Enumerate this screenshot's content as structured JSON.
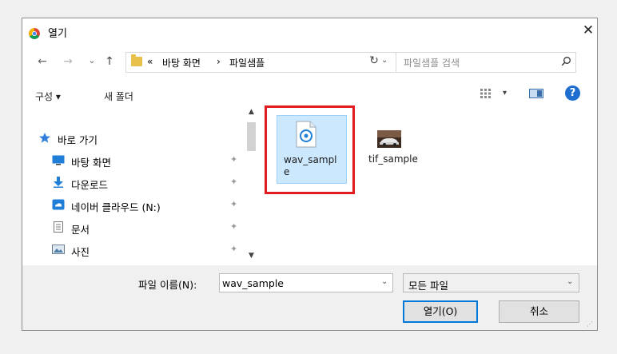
{
  "window": {
    "title": "열기",
    "close_symbol": "✕"
  },
  "nav": {
    "back": "←",
    "forward": "→",
    "recent": "⌄",
    "up": "↑"
  },
  "address": {
    "overflow": "«",
    "crumb1": "바탕 화면",
    "sep": "›",
    "crumb2": "파일샘플",
    "dropdown": "⌄"
  },
  "refresh": "↻",
  "search": {
    "placeholder": "파일샘플 검색",
    "icon": "search-icon"
  },
  "toolbar": {
    "organize": "구성 ▾",
    "new_folder": "새 폴더",
    "views_drop": "▾"
  },
  "sidebar": {
    "items": [
      {
        "label": "바로 가기",
        "icon": "star-icon",
        "pin": ""
      },
      {
        "label": "바탕 화면",
        "icon": "desktop-icon",
        "pin": "✦"
      },
      {
        "label": "다운로드",
        "icon": "download-icon",
        "pin": "✦"
      },
      {
        "label": "네이버 클라우드 (N:)",
        "icon": "cloud-drive-icon",
        "pin": "✦"
      },
      {
        "label": "문서",
        "icon": "document-icon",
        "pin": "✦"
      },
      {
        "label": "사진",
        "icon": "pictures-icon",
        "pin": "✦"
      }
    ],
    "scroll_up": "▲",
    "scroll_down": "▼"
  },
  "files": [
    {
      "name_line1": "wav_sampl",
      "name_line2": "e",
      "icon": "audio-file-icon",
      "selected": true
    },
    {
      "name_line1": "tif_sample",
      "name_line2": "",
      "icon": "image-thumbnail-icon",
      "selected": false
    }
  ],
  "footer": {
    "filename_label": "파일 이름(N):",
    "filename_value": "wav_sample",
    "filename_dropdown": "⌄",
    "filetype_value": "모든 파일",
    "filetype_dropdown": "⌄",
    "open_button": "열기(O)",
    "cancel_button": "취소",
    "grip": "⋰"
  },
  "colors": {
    "accent": "#0078d7",
    "selection": "#cce8ff",
    "highlight_box": "#e01b22",
    "help": "#1e6ecf"
  }
}
